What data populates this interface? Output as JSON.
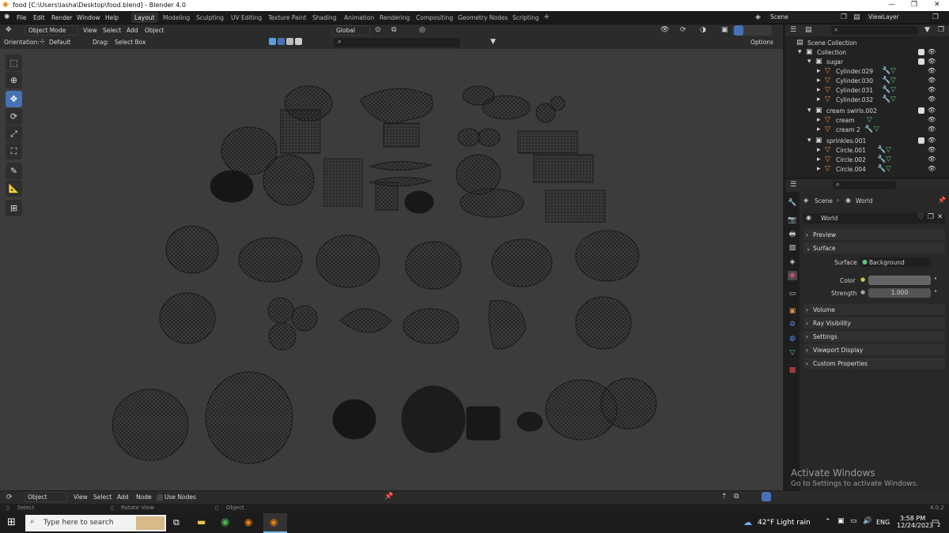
{
  "window": {
    "title": "food [C:\\Users\\lasha\\Desktop\\food.blend] - Blender 4.0"
  },
  "menu": [
    "File",
    "Edit",
    "Render",
    "Window",
    "Help"
  ],
  "workspaces": [
    "Layout",
    "Modeling",
    "Sculpting",
    "UV Editing",
    "Texture Paint",
    "Shading",
    "Animation",
    "Rendering",
    "Compositing",
    "Geometry Nodes",
    "Scripting"
  ],
  "active_workspace": "Layout",
  "scene": {
    "label": "Scene",
    "view_layer": "ViewLayer"
  },
  "viewport_header": {
    "mode": "Object Mode",
    "view": "View",
    "select": "Select",
    "add": "Add",
    "object": "Object",
    "transform": "Global",
    "orientation_label": "Orientation:",
    "orientation": "Default",
    "drag_label": "Drag:",
    "drag": "Select Box",
    "options": "Options"
  },
  "outliner": {
    "root": "Scene Collection",
    "rows": [
      {
        "name": "Collection",
        "level": 0
      },
      {
        "name": "sugar",
        "level": 1
      },
      {
        "name": "Cylinder.029",
        "level": 2
      },
      {
        "name": "Cylinder.030",
        "level": 2
      },
      {
        "name": "Cylinder.031",
        "level": 2
      },
      {
        "name": "Cylinder.032",
        "level": 2
      },
      {
        "name": "cream swirls.002",
        "level": 1
      },
      {
        "name": "cream",
        "level": 2
      },
      {
        "name": "cream 2",
        "level": 2
      },
      {
        "name": "sprinkles.001",
        "level": 1
      },
      {
        "name": "Circle.001",
        "level": 2
      },
      {
        "name": "Circle.002",
        "level": 2
      },
      {
        "name": "Circle.004",
        "level": 2
      }
    ]
  },
  "properties": {
    "breadcrumb_scene": "Scene",
    "breadcrumb_world": "World",
    "world_name": "World",
    "panels": [
      "Preview",
      "Surface",
      "Volume",
      "Ray Visibility",
      "Settings",
      "Viewport Display",
      "Custom Properties"
    ],
    "surface_label": "Surface",
    "surface_value": "Background",
    "color_label": "Color",
    "strength_label": "Strength",
    "strength_value": "1.000"
  },
  "timeline": {
    "mode": "Object",
    "view": "View",
    "select": "Select",
    "add": "Add",
    "node": "Node",
    "use_nodes": "Use Nodes"
  },
  "status": {
    "select": "Select",
    "rotate": "Rotate View",
    "object": "Object",
    "version": "4.0.2"
  },
  "watermark": {
    "line1": "Activate Windows",
    "line2": "Go to Settings to activate Windows."
  },
  "taskbar": {
    "search": "Type here to search",
    "weather": "42°F  Light rain",
    "lang": "ENG",
    "time": "3:58 PM",
    "date": "12/24/2023",
    "notif": "2"
  },
  "colors": {
    "accent": "#4772b3",
    "viewport": "#3c3c3c",
    "orange": "#e8903c",
    "green": "#5ec27a"
  }
}
